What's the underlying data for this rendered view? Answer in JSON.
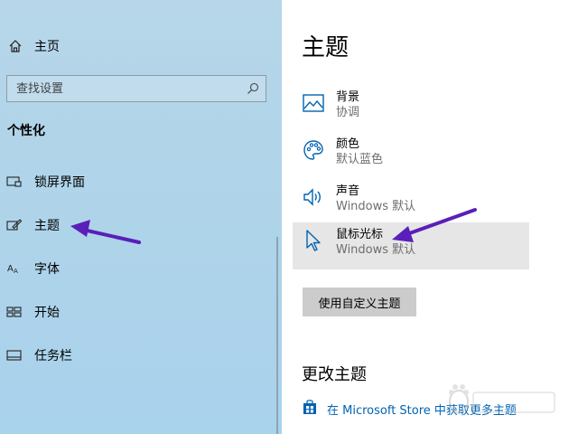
{
  "sidebar": {
    "home": {
      "label": "主页",
      "icon": "home-icon"
    },
    "search": {
      "placeholder": "查找设置",
      "icon": "search-icon"
    },
    "section_title": "个性化",
    "items": [
      {
        "label": "锁屏界面",
        "icon": "lock-screen-icon"
      },
      {
        "label": "主题",
        "icon": "theme-brush-icon"
      },
      {
        "label": "字体",
        "icon": "font-icon"
      },
      {
        "label": "开始",
        "icon": "start-icon"
      },
      {
        "label": "任务栏",
        "icon": "taskbar-icon"
      }
    ]
  },
  "main": {
    "title": "主题",
    "items": [
      {
        "name": "背景",
        "value": "协调",
        "icon": "picture-icon"
      },
      {
        "name": "颜色",
        "value": "默认蓝色",
        "icon": "palette-icon"
      },
      {
        "name": "声音",
        "value": "Windows 默认",
        "icon": "speaker-icon"
      },
      {
        "name": "鼠标光标",
        "value": "Windows 默认",
        "icon": "cursor-icon"
      }
    ],
    "custom_button": "使用自定义主题",
    "change_title": "更改主题",
    "store_link": "在 Microsoft Store 中获取更多主题"
  },
  "colors": {
    "accent": "#0063b1",
    "annotation_arrow": "#5a1fb8",
    "sidebar_bg": "#b0d4e9",
    "selected_bg": "#e6e6e6"
  }
}
